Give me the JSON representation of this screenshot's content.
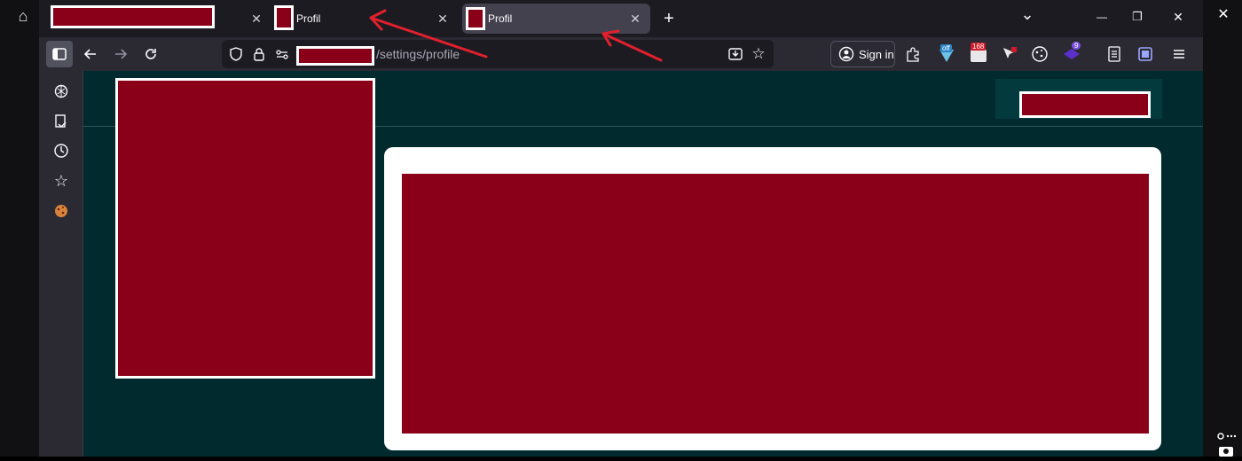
{
  "os": {
    "home_glyph": "⌂",
    "close_glyph": "✕"
  },
  "tabs": [
    {
      "title": "",
      "active": false
    },
    {
      "title": "Profil",
      "active": false
    },
    {
      "title": "Profil",
      "active": true
    }
  ],
  "tabstrip": {
    "new_tab_glyph": "+",
    "list_tabs_glyph": "⌄",
    "close_glyph": "✕"
  },
  "window_controls": {
    "minimize": "—",
    "restore": "❐",
    "close": "✕"
  },
  "navbar": {
    "url_host": "",
    "url_path": "/settings/profile",
    "sign_in_label": "Sign in"
  },
  "extensions": {
    "off_badge": "off",
    "count_badge": "168",
    "purple_badge": "9"
  },
  "sidebar": {
    "items": [
      "chatgpt-icon",
      "save-page-icon",
      "history-icon",
      "bookmarks-icon",
      "cookie-icon"
    ]
  },
  "annotations": {
    "arrow_color": "#e0202d",
    "count": 2
  },
  "colors": {
    "redaction": "#8a0018",
    "content_background": "#012a2e",
    "card_background": "#ffffff"
  }
}
